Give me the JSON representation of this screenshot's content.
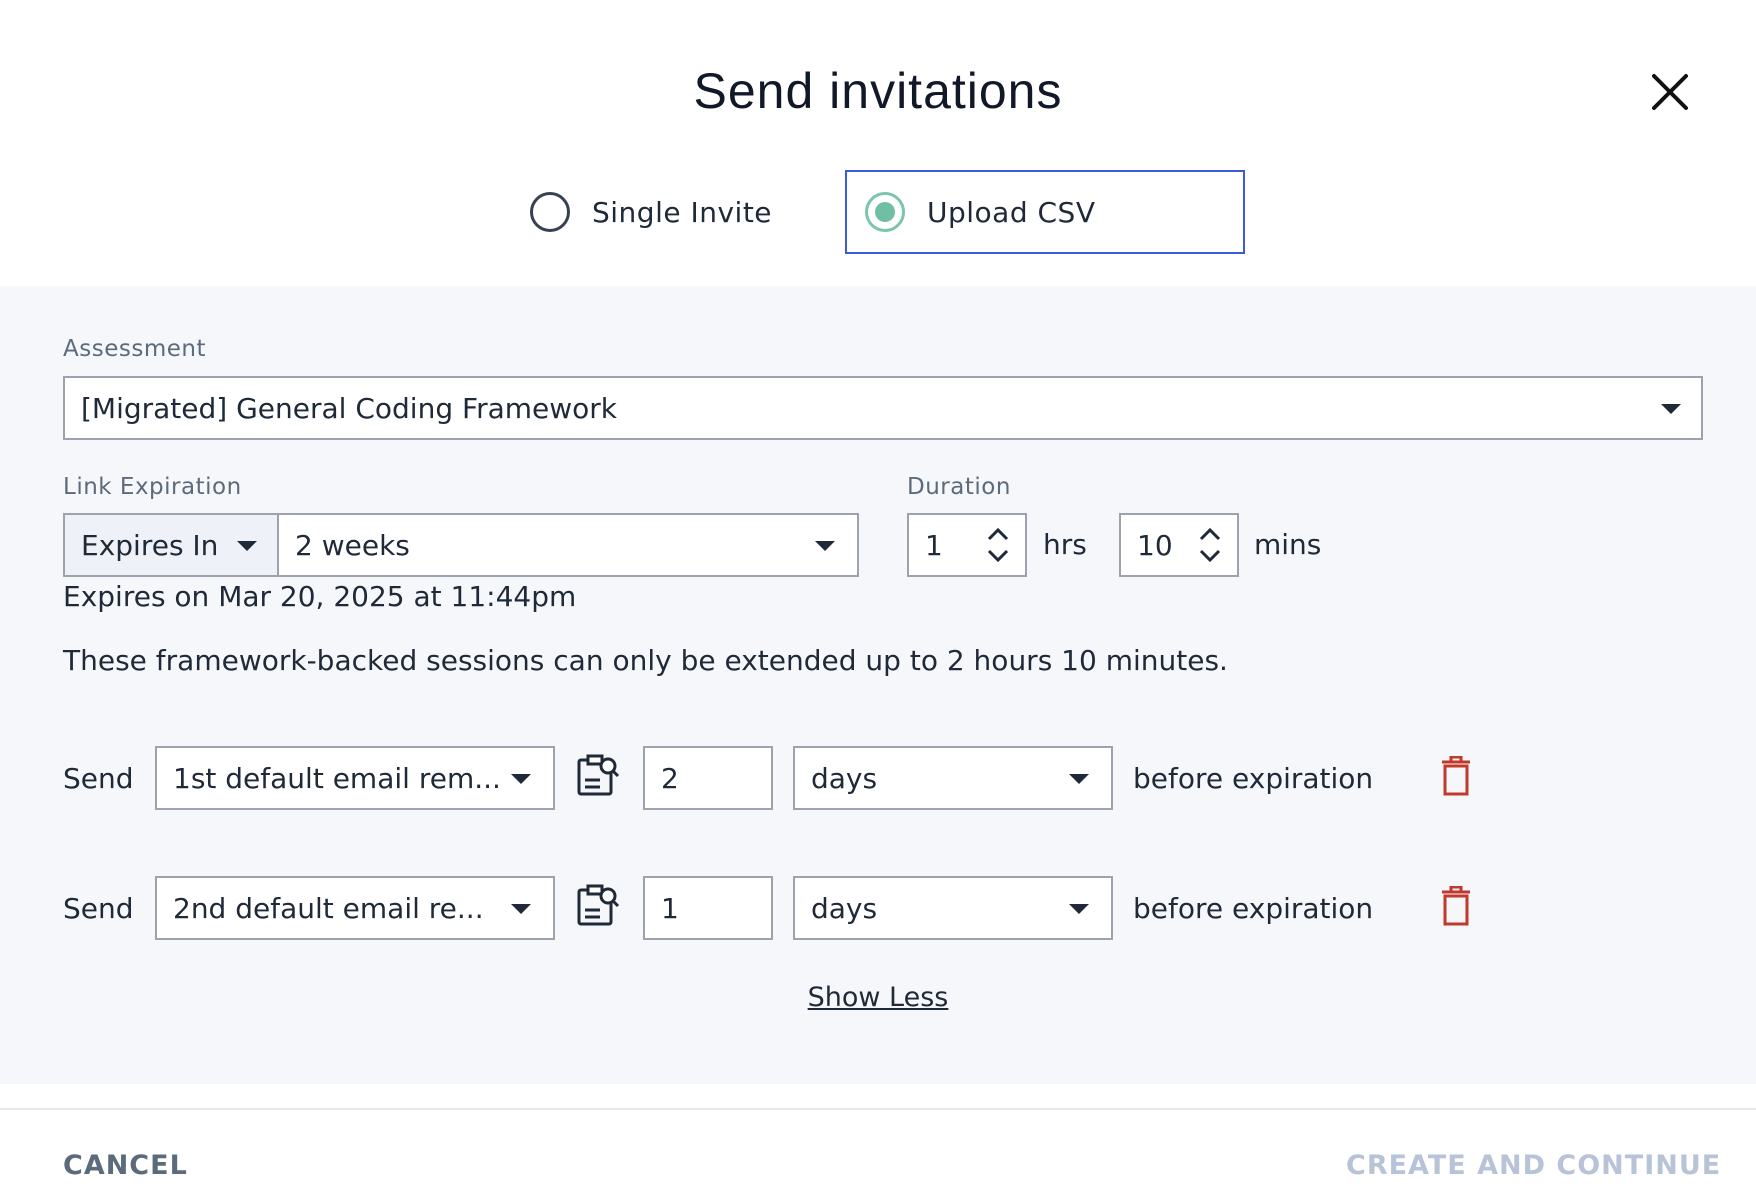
{
  "dialog": {
    "title": "Send invitations"
  },
  "mode": {
    "options": [
      {
        "label": "Single Invite",
        "selected": false
      },
      {
        "label": "Upload CSV",
        "selected": true
      }
    ]
  },
  "assessment": {
    "label": "Assessment",
    "value": "[Migrated] General Coding Framework"
  },
  "link_expiration": {
    "label": "Link Expiration",
    "mode_value": "Expires In",
    "period_value": "2 weeks",
    "expires_text": "Expires on Mar 20, 2025 at 11:44pm"
  },
  "duration": {
    "label": "Duration",
    "hours": "1",
    "hours_unit": "hrs",
    "minutes": "10",
    "minutes_unit": "mins"
  },
  "notice": "These framework-backed sessions can only be extended up to 2 hours 10 minutes.",
  "reminders": [
    {
      "send_label": "Send",
      "template": "1st default email rem...",
      "amount": "2",
      "unit": "days",
      "suffix": "before expiration"
    },
    {
      "send_label": "Send",
      "template": "2nd default email re...",
      "amount": "1",
      "unit": "days",
      "suffix": "before expiration"
    }
  ],
  "show_less": "Show Less",
  "footer": {
    "cancel": "CANCEL",
    "create": "CREATE AND CONTINUE"
  },
  "colors": {
    "accent_radio": "#6fbfa5",
    "focus_border": "#3b5bdb",
    "delete": "#c0392b",
    "panel_bg": "#f5f7fb",
    "disabled_text": "#b7c3d6"
  }
}
